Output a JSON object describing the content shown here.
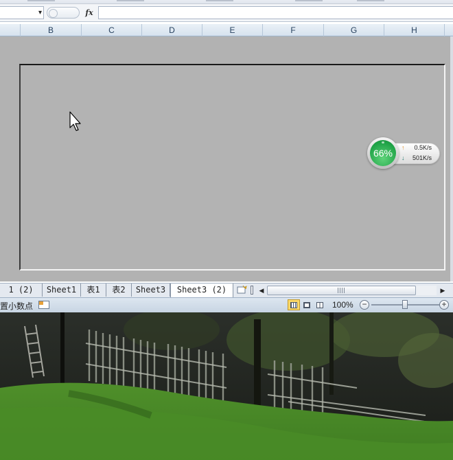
{
  "excel": {
    "formula_bar": {
      "fx_label": "fx",
      "name_box_dropdown_glyph": "▾"
    },
    "columns": [
      "B",
      "C",
      "D",
      "E",
      "F",
      "G",
      "H"
    ],
    "sheet_tabs": [
      "1 (2)",
      "Sheet1",
      "表1",
      "表2",
      "Sheet3",
      "Sheet3 (2)"
    ],
    "active_tab_index": 5,
    "status_bar": {
      "message": "置小数点",
      "zoom_label": "100%",
      "zoom_minus": "−",
      "zoom_plus": "+",
      "zoom_level_percent": 100
    },
    "scroll": {
      "left_arrow": "◀",
      "right_arrow": "▶"
    }
  },
  "speed_widget": {
    "percent": "66%",
    "upload": "0.5K/s",
    "download": "501K/s",
    "upload_arrow": "↑",
    "download_arrow": "↓"
  },
  "colors": {
    "sheet_background": "#b2b2b2",
    "speed_ball": "#1fa347",
    "active_view_button": "#fbd86a"
  },
  "icons": [
    "name-box-dropdown-icon",
    "formula-cancel-icon",
    "fx-icon",
    "mouse-pointer-icon",
    "insert-sheet-icon",
    "tab-split-icon",
    "macro-record-icon",
    "normal-view-icon",
    "page-layout-view-icon",
    "page-break-view-icon",
    "zoom-out-icon",
    "zoom-in-icon"
  ]
}
